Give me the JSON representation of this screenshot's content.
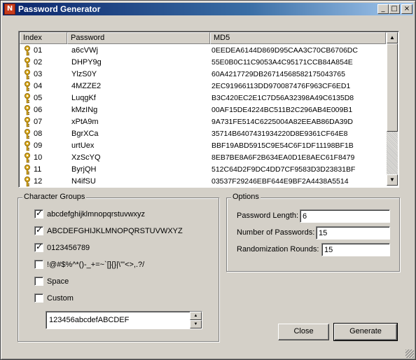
{
  "window": {
    "title": "Password Generator",
    "icon": "app-logo-icon",
    "buttons": {
      "minimize": "_",
      "maximize": "□",
      "close": "×"
    }
  },
  "table": {
    "columns": [
      "Index",
      "Password",
      "MD5"
    ],
    "rows": [
      {
        "index": "01",
        "password": "a6cVWj",
        "md5": "0EEDEA6144D869D95CAA3C70CB6706DC"
      },
      {
        "index": "02",
        "password": "DHPY9g",
        "md5": "55E0B0C11C9053A4C95171CCB84A854E"
      },
      {
        "index": "03",
        "password": "YlzS0Y",
        "md5": "60A4217729DB26714568582175043765"
      },
      {
        "index": "04",
        "password": "4MZZE2",
        "md5": "2EC91966113DD970087476F963CF6ED1"
      },
      {
        "index": "05",
        "password": "LuqgKf",
        "md5": "B3C420EC2E1C7D56A32398A49C6135D8"
      },
      {
        "index": "06",
        "password": "kMzINg",
        "md5": "00AF15DE4224BC511B2C296AB4E009B1"
      },
      {
        "index": "07",
        "password": "xPtA9m",
        "md5": "9A731FE514C6225004A82EEAB86DA39D"
      },
      {
        "index": "08",
        "password": "BgrXCa",
        "md5": "35714B6407431934220D8E9361CF64E8"
      },
      {
        "index": "09",
        "password": "urtUex",
        "md5": "BBF19ABD5915C9E54C6F1DF11198BF1B"
      },
      {
        "index": "10",
        "password": "XzScYQ",
        "md5": "8EB7BE8A6F2B634EA0D1E8AEC61F8479"
      },
      {
        "index": "11",
        "password": "ByrjQH",
        "md5": "512C64D2F9DC4DD7CF9583D3D23831BF"
      },
      {
        "index": "12",
        "password": "N4ifSU",
        "md5": "03537F29246EBF644E9BF2A4438A5514"
      }
    ],
    "row_icon": "key-icon"
  },
  "character_groups": {
    "title": "Character Groups",
    "options": [
      {
        "label": "abcdefghijklmnopqrstuvwxyz",
        "checked": true
      },
      {
        "label": "ABCDEFGHIJKLMNOPQRSTUVWXYZ",
        "checked": true
      },
      {
        "label": "0123456789",
        "checked": true
      },
      {
        "label": "!@#$%^*()-_+=~`[]{}|\\\"'<>,.?/",
        "checked": false
      },
      {
        "label": "Space",
        "checked": false
      },
      {
        "label": "Custom",
        "checked": false
      }
    ],
    "custom_value": "123456abcdefABCDEF"
  },
  "options": {
    "title": "Options",
    "password_length_label": "Password Length:",
    "password_length": "6",
    "number_of_passwords_label": "Number of Passwords:",
    "number_of_passwords": "15",
    "randomization_rounds_label": "Randomization Rounds:",
    "randomization_rounds": "15"
  },
  "buttons": {
    "close": "Close",
    "generate": "Generate"
  },
  "colors": {
    "titlebar_start": "#0a246a",
    "titlebar_end": "#a6caf0",
    "face": "#d4d0c8",
    "key_gold": "#d8a818"
  }
}
